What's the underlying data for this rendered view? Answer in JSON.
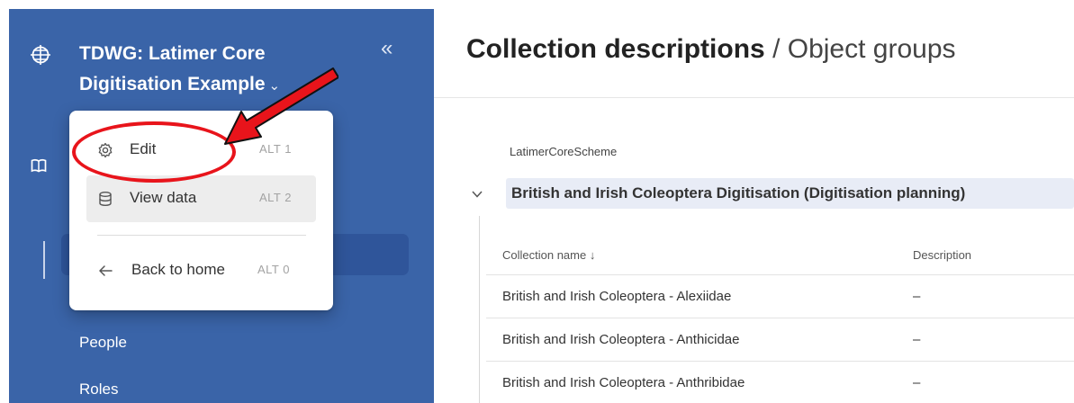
{
  "sidebar": {
    "app_title": "TDWG: Latimer Core Digitisation Example",
    "title_caret": "⌄",
    "collapse_glyph": "«",
    "nav": {
      "people": "People",
      "roles": "Roles"
    }
  },
  "menu": {
    "edit": {
      "label": "Edit",
      "shortcut": "ALT 1",
      "icon": "gear-icon"
    },
    "view_data": {
      "label": "View data",
      "shortcut": "ALT 2",
      "icon": "database-icon"
    },
    "back_home": {
      "label": "Back to home",
      "shortcut": "ALT 0",
      "icon": "arrow-left-icon"
    }
  },
  "main": {
    "title_primary": "Collection descriptions",
    "title_separator": "/",
    "title_secondary": "Object groups",
    "scheme_label": "LatimerCoreScheme",
    "scheme_name": "British and Irish Coleoptera Digitisation (Digitisation planning)",
    "table": {
      "columns": [
        "Collection name ↓",
        "Description"
      ],
      "rows": [
        [
          "British and Irish Coleoptera - Alexiidae",
          "–"
        ],
        [
          "British and Irish Coleoptera - Anthicidae",
          "–"
        ],
        [
          "British and Irish Coleoptera - Anthribidae",
          "–"
        ]
      ]
    }
  },
  "colors": {
    "sidebar_bg": "#3a64a8",
    "annotation_red": "#e8141b",
    "scheme_chip_bg": "#e8ecf6"
  }
}
